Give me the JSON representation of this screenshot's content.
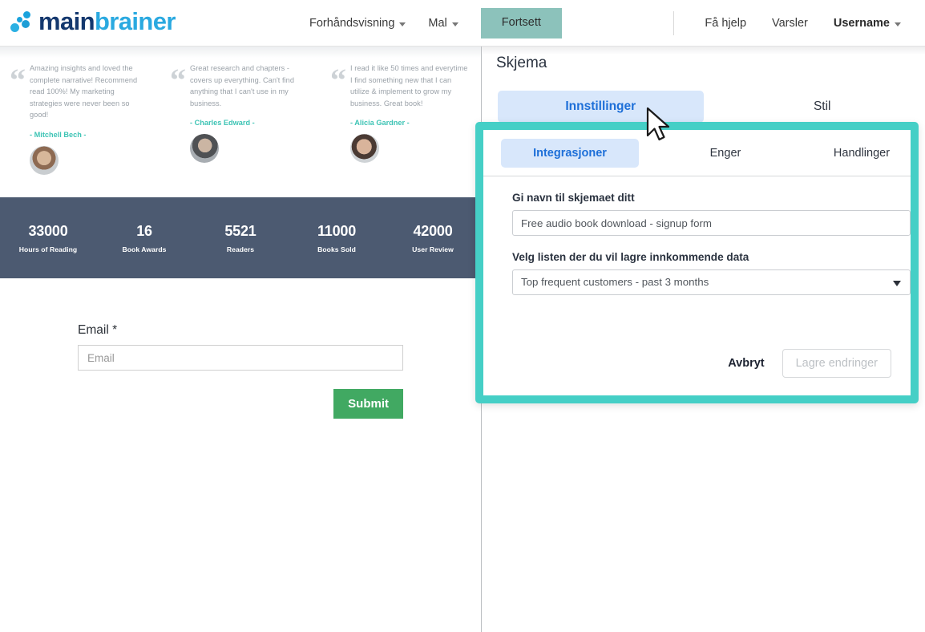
{
  "header": {
    "logo": {
      "part1": "main",
      "part2": "brainer",
      "icon": "logo-dots-icon"
    },
    "nav": [
      {
        "label": "Forhåndsvisning",
        "has_caret": true
      },
      {
        "label": "Mal",
        "has_caret": true
      }
    ],
    "primary_button": "Fortsett",
    "right_nav": [
      {
        "label": "Få hjelp",
        "has_caret": false,
        "bold": false
      },
      {
        "label": "Varsler",
        "has_caret": false,
        "bold": false
      },
      {
        "label": "Username",
        "has_caret": true,
        "bold": true
      }
    ]
  },
  "preview": {
    "testimonials": [
      {
        "quote": "Amazing insights and loved the complete narrative! Recommend read 100%! My marketing strategies were never been so good!",
        "author": "- Mitchell Bech -"
      },
      {
        "quote": "Great research and chapters - covers up everything. Can't find anything that I can't use in my business.",
        "author": "- Charles Edward -"
      },
      {
        "quote": "I read it like 50 times and everytime I find something new that I can utilize & implement to grow my business. Great book!",
        "author": "- Alicia Gardner -"
      }
    ],
    "stats": [
      {
        "number": "33000",
        "label": "Hours of Reading"
      },
      {
        "number": "16",
        "label": "Book Awards"
      },
      {
        "number": "5521",
        "label": "Readers"
      },
      {
        "number": "11000",
        "label": "Books Sold"
      },
      {
        "number": "42000",
        "label": "User Review"
      }
    ],
    "form": {
      "email_label": "Email",
      "email_required_mark": "*",
      "email_placeholder": "Email",
      "email_value": "",
      "submit_label": "Submit"
    }
  },
  "panel": {
    "title": "Skjema",
    "outer_tabs": [
      {
        "label": "Innstillinger",
        "active": true
      },
      {
        "label": "Stil",
        "active": false
      }
    ]
  },
  "modal": {
    "inner_tabs": [
      {
        "label": "Integrasjoner",
        "active": true
      },
      {
        "label": "Enger",
        "active": false
      },
      {
        "label": "Handlinger",
        "active": false
      }
    ],
    "fields": {
      "name_label": "Gi navn til skjemaet ditt",
      "name_value": "Free audio book download - signup form",
      "name_placeholder": "Gi navn til skjemaet ditt",
      "list_label": "Velg listen der du vil lagre innkommende data",
      "list_value": "Top frequent customers - past 3 months"
    },
    "actions": {
      "cancel_label": "Avbryt",
      "save_label": "Lagre endringer"
    }
  },
  "colors": {
    "accent_teal": "#45cfc6",
    "tab_active_bg": "#d8e7fb",
    "tab_active_text": "#1d6fd8",
    "stats_bg": "#4c5a71",
    "submit_green": "#41a962",
    "continue_button": "#8cc2bb",
    "author_teal": "#3ec4b5"
  }
}
